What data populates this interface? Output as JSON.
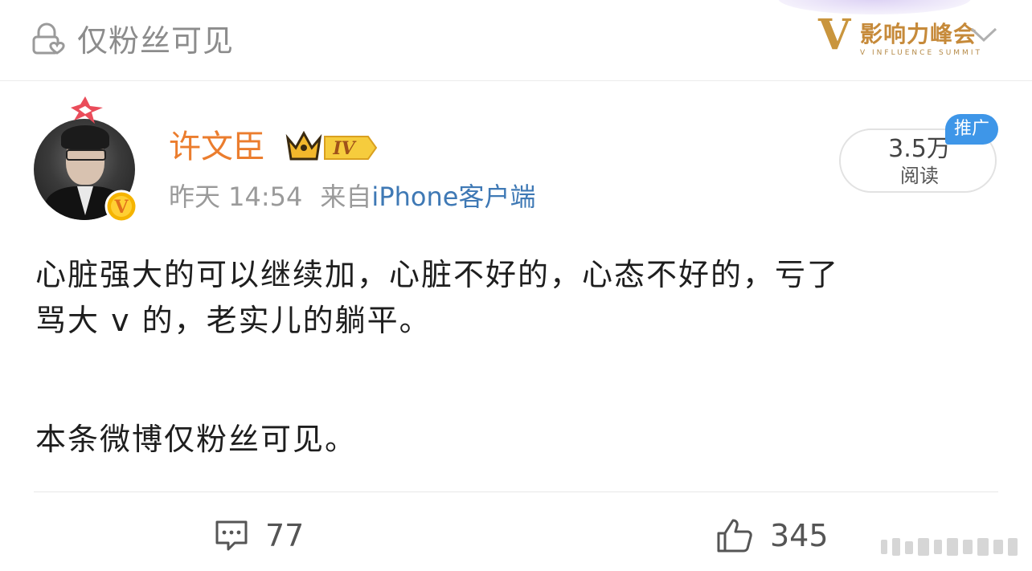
{
  "header": {
    "visibility_label": "仅粉丝可见",
    "summit_logo_letter": "V",
    "summit_title": "影响力峰会",
    "summit_subtitle": "V INFLUENCE SUMMIT"
  },
  "user": {
    "name": "许文臣",
    "level_badge": "IV",
    "time": "昨天 14:54",
    "source_prefix": "来自",
    "source_device": "iPhone客户端",
    "verified_letter": "V"
  },
  "stats": {
    "reads_count": "3.5万",
    "reads_label": "阅读",
    "promo_tag": "推广"
  },
  "post": {
    "lines": [
      "心脏强大的可以继续加，心脏不好的，心态不好的，亏了",
      "骂大 v 的，老实儿的躺平。"
    ],
    "note": "本条微博仅粉丝可见。"
  },
  "actions": {
    "comments": "77",
    "likes": "345"
  },
  "colors": {
    "username": "#eb7d2e",
    "device_link": "#3f79b5",
    "meta_gray": "#9a9a9a",
    "promo_blue": "#3e96e8",
    "summit_gold": "#c68a3a"
  },
  "icons": {
    "visibility": "lock-heart-icon",
    "dropdown": "chevron-down-icon",
    "level": "crown-icon",
    "verified": "verified-v-icon",
    "comment": "comment-icon",
    "like": "thumbs-up-icon"
  }
}
